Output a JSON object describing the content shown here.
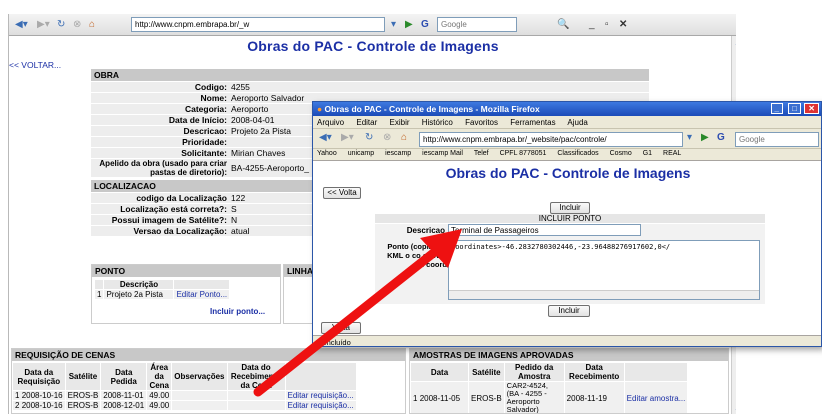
{
  "browser": {
    "url": "http://www.cnpm.embrapa.br/_w",
    "search_placeholder": "Google"
  },
  "page": {
    "title": "Obras do PAC - Controle de Imagens",
    "voltar": "<< VOLTAR...",
    "obra": {
      "header": "OBRA",
      "fields": [
        {
          "label": "Codigo:",
          "value": "4255"
        },
        {
          "label": "Nome:",
          "value": "Aeroporto Salvador"
        },
        {
          "label": "Categoria:",
          "value": "Aeroporto"
        },
        {
          "label": "Data de Início:",
          "value": "2008-04-01"
        },
        {
          "label": "Descricao:",
          "value": "Projeto 2a Pista"
        },
        {
          "label": "Prioridade:",
          "value": ""
        },
        {
          "label": "Solicitante:",
          "value": "Mirian Chaves"
        },
        {
          "label": "Apelido da obra (usado para criar pastas de diretorio):",
          "value": "BA-4255-Aeroporto_"
        }
      ]
    },
    "localizacao": {
      "header": "LOCALIZACAO",
      "fields": [
        {
          "label": "codigo da Localização",
          "value": "122"
        },
        {
          "label": "Localização está correta?:",
          "value": "S"
        },
        {
          "label": "Possui imagem de Satélite?:",
          "value": "N"
        },
        {
          "label": "Versao da Localização:",
          "value": "atual"
        }
      ]
    },
    "ponto": {
      "header": "PONTO",
      "col": "Descrição",
      "rows": [
        {
          "n": "1",
          "desc": "Projeto 2a Pista",
          "action": "Editar Ponto..."
        }
      ],
      "include": "Incluir ponto...",
      "linha_header": "LINHA"
    },
    "requisicao": {
      "header": "REQUISIÇÃO DE CENAS",
      "columns": [
        "Data da Requisição",
        "Satélite",
        "Data Pedida",
        "Área da Cena",
        "Observações",
        "Data do Recebimento da Cena"
      ],
      "rows": [
        {
          "n": "1",
          "data": "2008-10-16",
          "sat": "EROS-B",
          "pedida": "2008-11-01",
          "area": "49.00",
          "action": "Editar requisição..."
        },
        {
          "n": "2",
          "data": "2008-10-16",
          "sat": "EROS-B",
          "pedida": "2008-12-01",
          "area": "49.00",
          "action": "Editar requisição..."
        }
      ]
    },
    "amostras": {
      "header": "AMOSTRAS DE IMAGENS APROVADAS",
      "columns": [
        "Data",
        "Satélite",
        "Pedido da Amostra",
        "Data Recebimento"
      ],
      "rows": [
        {
          "n": "1",
          "data": "2008-11-05",
          "sat": "EROS-B",
          "pedido": "CAR2-4524, (BA - 4255 - Aeroporto Salvador)",
          "receb": "2008-11-19",
          "action": "Editar amostra..."
        }
      ]
    }
  },
  "popup": {
    "window_title": "Obras do PAC - Controle de Imagens - Mozilla Firefox",
    "menu": [
      "Arquivo",
      "Editar",
      "Exibir",
      "Histórico",
      "Favoritos",
      "Ferramentas",
      "Ajuda"
    ],
    "url": "http://www.cnpm.embrapa.br/_website/pac/controle/",
    "search_placeholder": "Google",
    "bookmarks": [
      "Yahoo",
      "unicamp",
      "iescamp",
      "iescamp Mail",
      "Telef",
      "CPFL 8778051",
      "Classificados",
      "Cosmo",
      "G1",
      "REAL"
    ],
    "page_title": "Obras do PAC - Controle de Imagens",
    "volta": "<< Volta",
    "incluir": "Incluir",
    "incluir_ponto": "INCLUIR PONTO",
    "descricao_label": "Descricao",
    "descricao_value": "Terminal de Passageiros",
    "ponto_label": "Ponto (copiar do KML o co estiver em coord",
    "ponto_value": "coordinates>-46.2832780302446,-23.96488276917602,0</",
    "incluir2": "Incluir",
    "volta2": "Volta",
    "status": "Concluído"
  }
}
